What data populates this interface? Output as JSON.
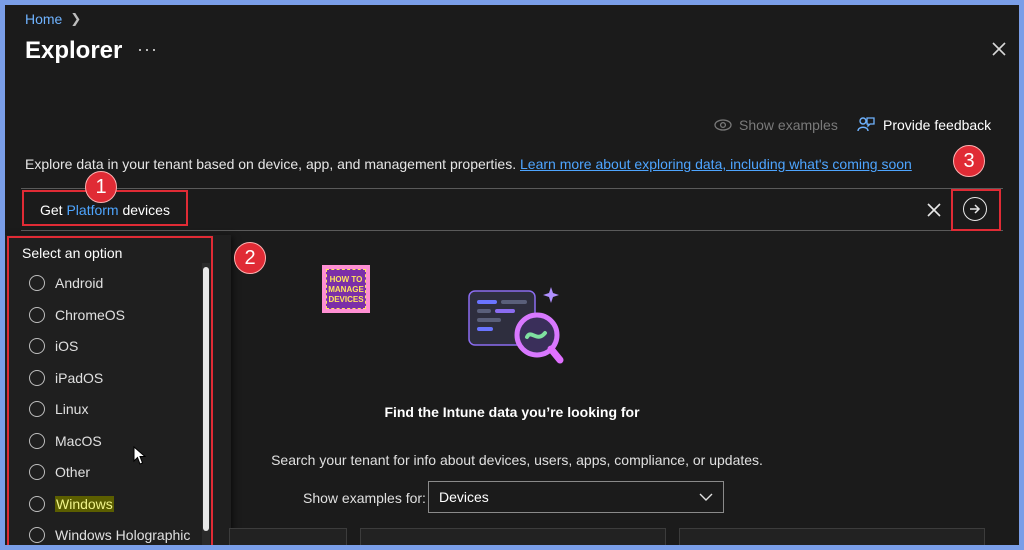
{
  "breadcrumb": {
    "home": "Home"
  },
  "header": {
    "title": "Explorer",
    "more": "···"
  },
  "toolbar": {
    "show_examples": "Show examples",
    "provide_feedback": "Provide feedback"
  },
  "intro": {
    "text": "Explore data in your tenant based on device, app, and management properties.",
    "link": "Learn more about exploring data, including what's coming soon"
  },
  "query": {
    "prefix": "Get",
    "token": "Platform",
    "suffix": "devices"
  },
  "annotations": {
    "one": "1",
    "two": "2",
    "three": "3"
  },
  "dropdown": {
    "header": "Select an option",
    "options": [
      "Android",
      "ChromeOS",
      "iOS",
      "iPadOS",
      "Linux",
      "MacOS",
      "Other",
      "Windows",
      "Windows Holographic"
    ],
    "highlighted": "Windows"
  },
  "logo": {
    "line1": "HOW TO",
    "line2": "MANAGE",
    "line3": "DEVICES"
  },
  "hero": {
    "title": "Find the Intune data you’re looking for",
    "subtitle": "Search your tenant for info about devices, users, apps, compliance, or updates."
  },
  "examples": {
    "label": "Show examples for:",
    "selected": "Devices"
  },
  "colors": {
    "accent_link": "#4ea5ff",
    "annotation_red": "#e02b35",
    "highlight": "#5b5e00"
  }
}
